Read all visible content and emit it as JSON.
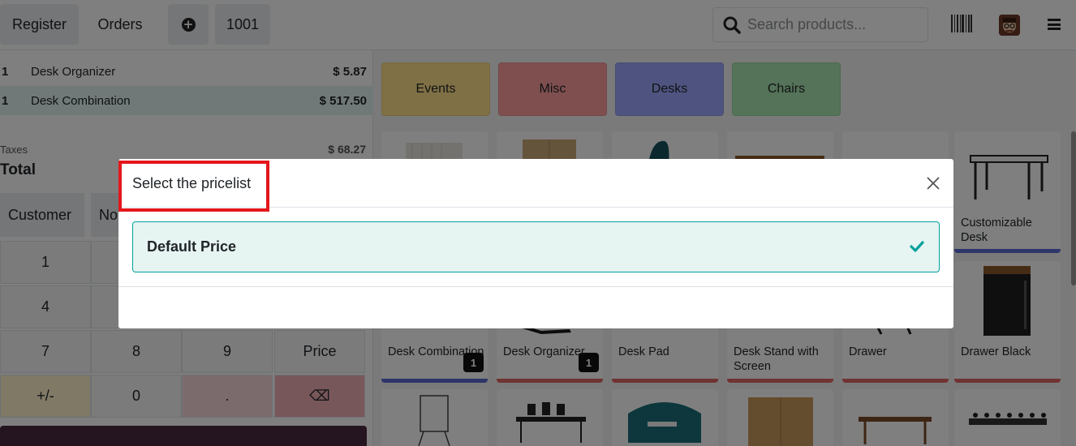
{
  "topbar": {
    "register": "Register",
    "orders": "Orders",
    "add_icon": "plus-circle-icon",
    "order_number": "1001",
    "search_placeholder": "Search products...",
    "search_icon": "search-icon",
    "barcode_icon": "barcode-icon",
    "menu_icon": "hamburger-menu-icon"
  },
  "order": {
    "lines": [
      {
        "qty": "1",
        "name": "Desk Organizer",
        "price": "$ 5.87"
      },
      {
        "qty": "1",
        "name": "Desk Combination",
        "price": "$ 517.50"
      }
    ],
    "taxes_label": "Taxes",
    "taxes_value": "$ 68.27",
    "total_label": "Total"
  },
  "controls": {
    "customer": "Customer",
    "note_partial": "No"
  },
  "numpad": {
    "k1": "1",
    "k4": "4",
    "k7": "7",
    "k8": "8",
    "k9": "9",
    "price": "Price",
    "plusminus": "+/-",
    "k0": "0",
    "dot": ".",
    "backspace": "⌫"
  },
  "categories": [
    {
      "label": "Events",
      "color": "#ffe08a"
    },
    {
      "label": "Misc",
      "color": "#ff9e9e"
    },
    {
      "label": "Desks",
      "color": "#9ca8ff"
    },
    {
      "label": "Chairs",
      "color": "#a8e6b0"
    }
  ],
  "products": {
    "customizable_desk": "Customizable Desk",
    "desk_combination": "Desk Combination",
    "desk_organizer": "Desk Organizer",
    "desk_pad": "Desk Pad",
    "desk_stand": "Desk Stand with Screen",
    "drawer": "Drawer",
    "drawer_black": "Drawer Black",
    "badge_desk_combination": "1",
    "badge_desk_organizer": "1"
  },
  "modal": {
    "title": "Select the pricelist",
    "option": "Default Price",
    "check_icon": "checkmark-icon",
    "close_icon": "close-icon"
  },
  "colors": {
    "accent": "#00a09d",
    "highlight_border": "#e3171c",
    "pay_bar": "#4a2a40"
  }
}
